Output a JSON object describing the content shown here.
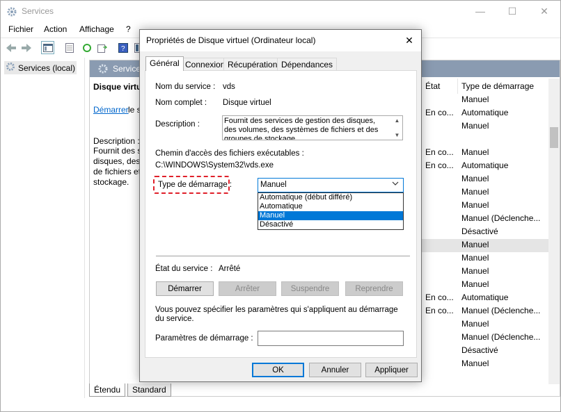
{
  "main_window": {
    "title": "Services",
    "menu": [
      "Fichier",
      "Action",
      "Affichage",
      "?"
    ],
    "tree_item": "Services (local)",
    "pane_header": "Service",
    "detail": {
      "title": "Disque virtu",
      "link": "Démarrer",
      "link_rest": "le s",
      "desc_label": "Description :",
      "desc_lines": [
        "Fournit des s",
        "disques, des",
        "de fichiers et",
        "stockage."
      ]
    },
    "columns": {
      "state": "État",
      "start_type": "Type de démarrage"
    },
    "list_rows": [
      {
        "state": "",
        "start": "Manuel"
      },
      {
        "state": "En co...",
        "start": "Automatique"
      },
      {
        "state": "",
        "start": "Manuel"
      },
      {
        "state": "",
        "start": ""
      },
      {
        "state": "En co...",
        "start": "Manuel"
      },
      {
        "state": "En co...",
        "start": "Automatique"
      },
      {
        "state": "",
        "start": "Manuel"
      },
      {
        "state": "",
        "start": "Manuel"
      },
      {
        "state": "",
        "start": "Manuel"
      },
      {
        "state": "",
        "start": "Manuel (Déclenche..."
      },
      {
        "state": "",
        "start": "Désactivé"
      },
      {
        "state": "",
        "start": "Manuel"
      },
      {
        "state": "",
        "start": "Manuel"
      },
      {
        "state": "",
        "start": "Manuel"
      },
      {
        "state": "",
        "start": "Manuel"
      },
      {
        "state": "En co...",
        "start": "Automatique"
      },
      {
        "state": "En co...",
        "start": "Manuel (Déclenche..."
      },
      {
        "state": "",
        "start": "Manuel"
      },
      {
        "state": "",
        "start": "Manuel (Déclenche..."
      },
      {
        "state": "",
        "start": "Désactivé"
      },
      {
        "state": "",
        "start": "Manuel"
      }
    ],
    "bottom_tabs": [
      "Étendu",
      "Standard"
    ]
  },
  "dialog": {
    "title": "Propriétés de Disque virtuel (Ordinateur local)",
    "tabs": [
      "Général",
      "Connexion",
      "Récupération",
      "Dépendances"
    ],
    "service_name_label": "Nom du service :",
    "service_name": "vds",
    "display_name_label": "Nom complet :",
    "display_name": "Disque virtuel",
    "description_label": "Description :",
    "description": "Fournit des services de gestion des disques, des volumes, des systèmes de fichiers et des groupes de stockage",
    "path_label": "Chemin d'accès des fichiers exécutables :",
    "path": "C:\\WINDOWS\\System32\\vds.exe",
    "startup_type_label": "Type de démarrage :",
    "startup_type_value": "Manuel",
    "startup_options": [
      "Automatique (début différé)",
      "Automatique",
      "Manuel",
      "Désactivé"
    ],
    "status_label": "État du service :",
    "status_value": "Arrêté",
    "buttons": {
      "start": "Démarrer",
      "stop": "Arrêter",
      "pause": "Suspendre",
      "resume": "Reprendre"
    },
    "params_hint": "Vous pouvez spécifier les paramètres qui s'appliquent au démarrage du service.",
    "params_label": "Paramètres de démarrage :",
    "params_value": "",
    "footer": {
      "ok": "OK",
      "cancel": "Annuler",
      "apply": "Appliquer"
    }
  },
  "colors": {
    "accent": "#0078d7",
    "highlight_dash": "#e0202a",
    "pane_header": "#8a9bb1"
  }
}
